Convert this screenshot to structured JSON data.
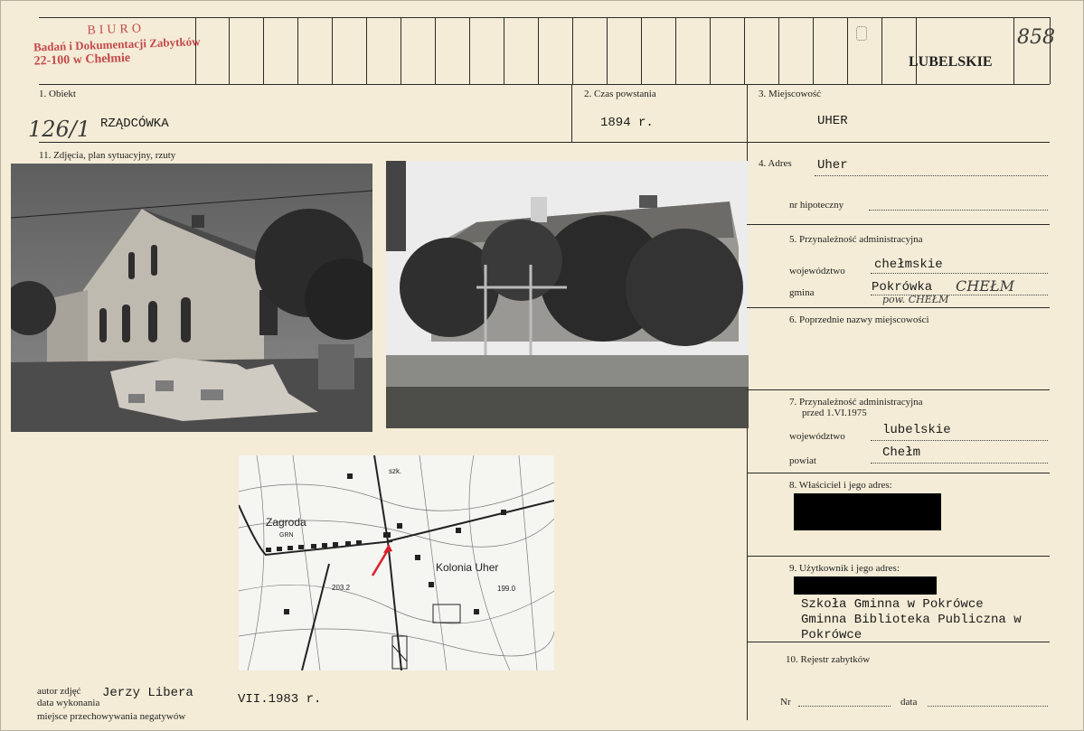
{
  "header": {
    "region": "LUBELSKIE",
    "catalog_number": "858",
    "stamp": {
      "line1": "BIURO",
      "line2": "Badań i Dokumentacji Zabytków",
      "line3": "22-100 w Chełmie"
    }
  },
  "fields": {
    "object": {
      "label": "1. Obiekt",
      "value": "RZĄDCÓWKA",
      "hand_note": "126/1"
    },
    "period": {
      "label": "2. Czas powstania",
      "value": "1894 r."
    },
    "locality": {
      "label": "3. Miejscowość",
      "value": "UHER"
    },
    "photos": {
      "label": "11. Zdjęcia, plan sytuacyjny, rzuty"
    },
    "address": {
      "label": "4. Adres",
      "value": "Uher",
      "mortgage_label": "nr hipoteczny"
    },
    "admin": {
      "label": "5. Przynależność administracyjna",
      "voivodeship_label": "województwo",
      "voivodeship_value": "chełmskie",
      "commune_label": "gmina",
      "commune_value": "Pokrówka",
      "hand_note1": "CHEŁM",
      "hand_note2": "pow. CHEŁM"
    },
    "former_names": {
      "label": "6. Poprzednie nazwy miejscowości"
    },
    "admin_before": {
      "label": "7. Przynależność administracyjna",
      "label2": "przed 1.VI.1975",
      "voivodeship_label": "województwo",
      "voivodeship_value": "lubelskie",
      "county_label": "powiat",
      "county_value": "Chełm"
    },
    "owner": {
      "label": "8. Właściciel i jego adres:"
    },
    "user": {
      "label": "9. Użytkownik i jego adres:",
      "line1": "Szkoła Gminna w Pokrówce",
      "line2": "Gminna Biblioteka Publiczna w",
      "line3": "Pokrówce"
    },
    "register": {
      "label": "10. Rejestr zabytków",
      "nr_label": "Nr",
      "date_label": "data"
    }
  },
  "footer": {
    "author_label": "autor zdjęć",
    "author_value": "Jerzy Libera",
    "date_label": "data wykonania",
    "date_value": "VII.1983 r.",
    "storage_label": "miejsce przechowywania negatywów"
  },
  "map": {
    "labels": [
      "Zagroda",
      "GRN",
      "Kolonia Uher",
      "203.2",
      "199.0",
      "szk."
    ],
    "arrow_color": "#d8202a"
  },
  "colors": {
    "card": "#f4ecd6",
    "stamp": "#c0373f",
    "ink": "#1a1a1a"
  }
}
